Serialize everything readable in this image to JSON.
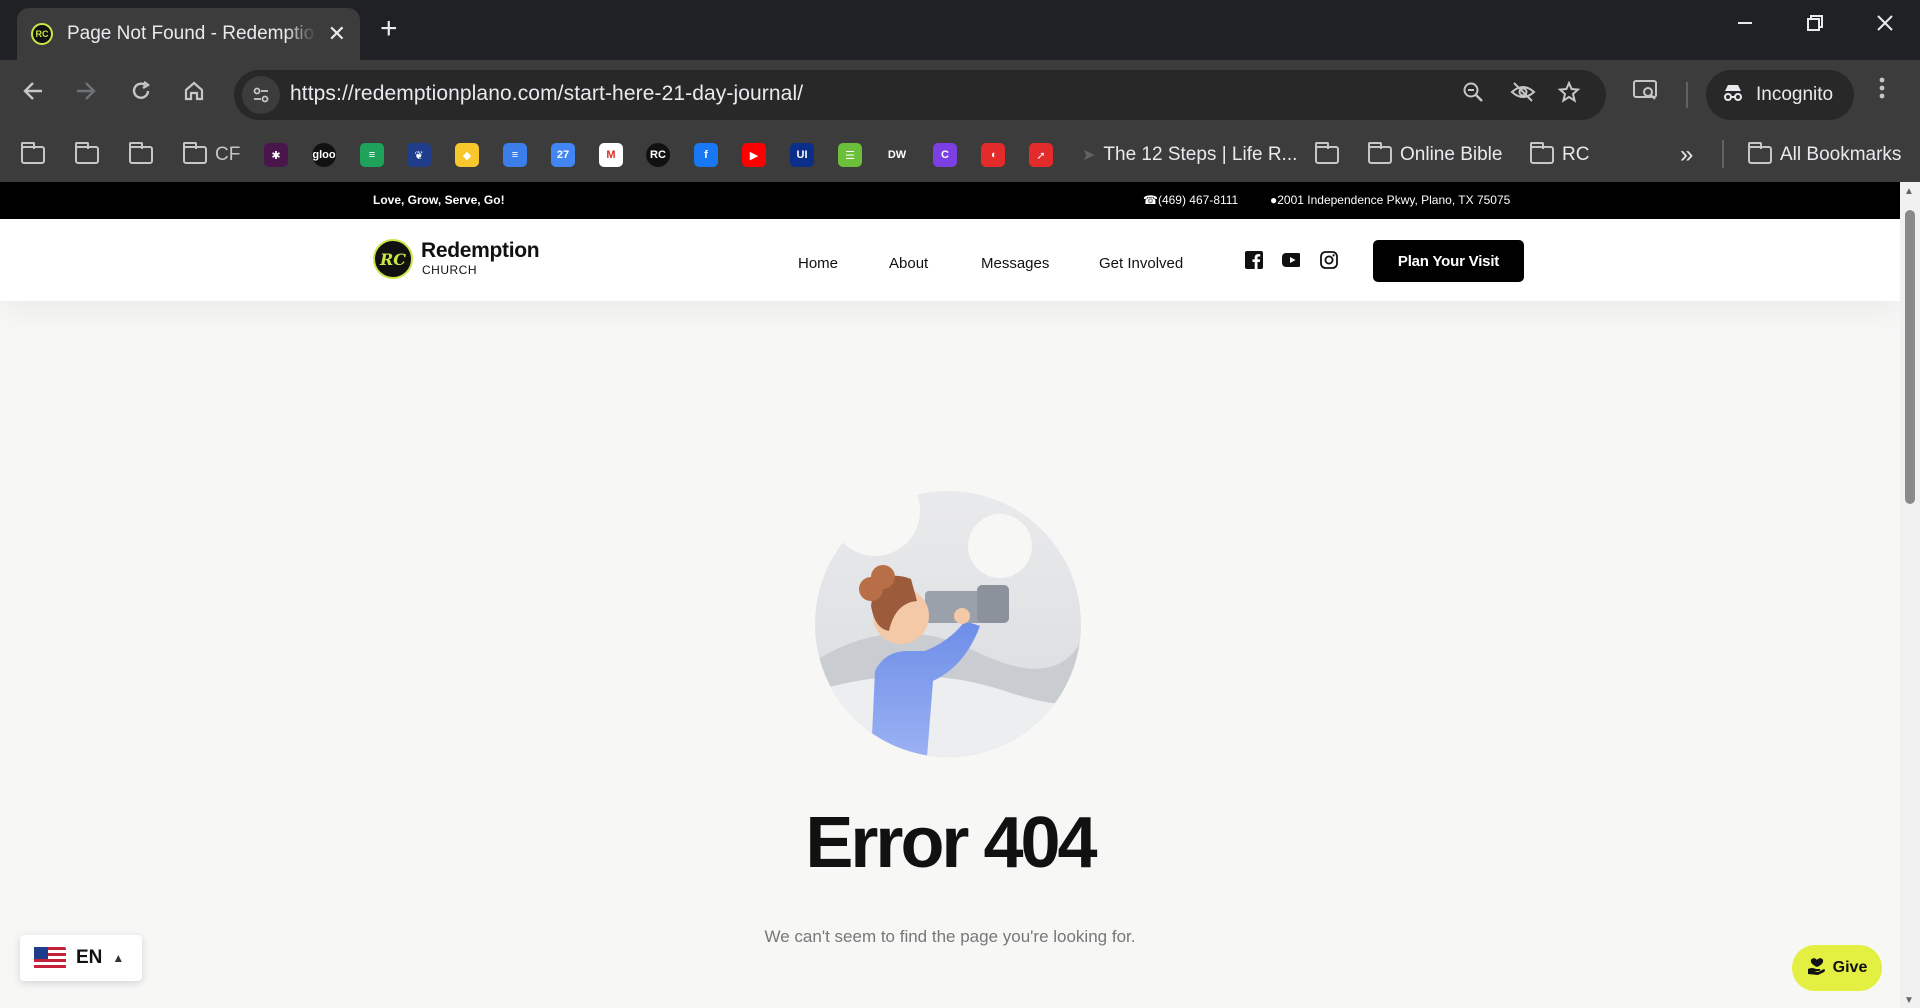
{
  "browser": {
    "tab_title": "Page Not Found - Redemption Church",
    "close_tab": "✕",
    "new_tab": "+",
    "url": "https://redemptionplano.com/start-here-21-day-journal/",
    "incognito_label": "Incognito",
    "bookmarks": {
      "cf": "CF",
      "twelve_steps": "The 12 Steps | Life R...",
      "online_bible": "Online Bible",
      "rc": "RC",
      "all": "All Bookmarks",
      "more": "»"
    },
    "app_icons": [
      {
        "name": "slack",
        "color": "#4a154b",
        "glyph": "✱"
      },
      {
        "name": "gloo",
        "color": "#111111",
        "glyph": "gloo"
      },
      {
        "name": "planning-center",
        "color": "#1fa35b",
        "glyph": "≡"
      },
      {
        "name": "tree",
        "color": "#1f3d8a",
        "glyph": "❦"
      },
      {
        "name": "keep",
        "color": "#f7c72b",
        "glyph": "◆"
      },
      {
        "name": "docs",
        "color": "#3b7de9",
        "glyph": "≡"
      },
      {
        "name": "calendar",
        "color": "#4285f4",
        "glyph": "27"
      },
      {
        "name": "gmail",
        "color": "#ffffff",
        "glyph": "M"
      },
      {
        "name": "rc-logo",
        "color": "#111111",
        "glyph": "RC"
      },
      {
        "name": "facebook",
        "color": "#1877f2",
        "glyph": "f"
      },
      {
        "name": "youtube",
        "color": "#ff0000",
        "glyph": "▶"
      },
      {
        "name": "ui",
        "color": "#0b2e8a",
        "glyph": "UI"
      },
      {
        "name": "sheets",
        "color": "#6cbf3a",
        "glyph": "☰"
      },
      {
        "name": "dw",
        "color": "#3c3c3c",
        "glyph": "DW"
      },
      {
        "name": "canva",
        "color": "#7b3fe4",
        "glyph": "C"
      },
      {
        "name": "headphones",
        "color": "#e32b2b",
        "glyph": "◖"
      },
      {
        "name": "arrow",
        "color": "#e32b2b",
        "glyph": "➚"
      }
    ]
  },
  "site": {
    "slogan": "Love, Grow, Serve, Go!",
    "phone": "(469) 467-8111",
    "address": "2001 Independence Pkwy, Plano, TX 75075",
    "logo_name": "Redemption",
    "logo_sub": "CHURCH",
    "logo_mark": "RC",
    "menu": [
      "Home",
      "About",
      "Messages",
      "Get Involved"
    ],
    "cta": "Plan Your Visit",
    "error_title": "Error 404",
    "error_sub": "We can't seem to find the page you're looking for.",
    "lang_code": "EN",
    "give": "Give",
    "accent": "#e3f042"
  }
}
